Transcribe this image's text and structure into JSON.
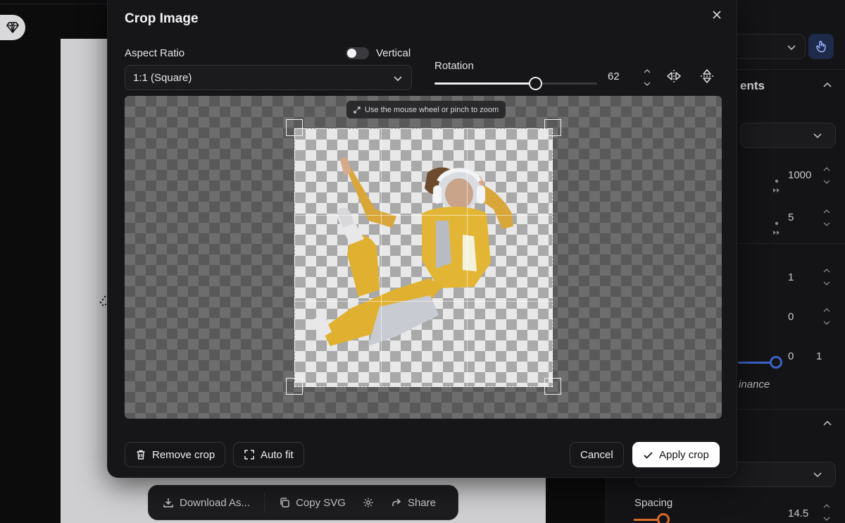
{
  "modal": {
    "title": "Crop Image",
    "aspect_ratio": {
      "label": "Aspect Ratio",
      "selected": "1:1 (Square)",
      "vertical_label": "Vertical",
      "vertical_on": false
    },
    "rotation": {
      "label": "Rotation",
      "value": "62",
      "level": 0.62
    },
    "hint": "Use the mouse wheel or pinch to zoom",
    "footer": {
      "remove_crop": "Remove crop",
      "auto_fit": "Auto fit",
      "cancel": "Cancel",
      "apply_crop": "Apply crop"
    }
  },
  "toolbar": {
    "download": "Download As...",
    "copy_svg": "Copy SVG",
    "share": "Share"
  },
  "right_panel": {
    "section_partial": "ents",
    "value_1": "1000",
    "value_2": "5",
    "value_3": "1",
    "value_4": "0",
    "range_min": "0",
    "range_max": "1",
    "italic_partial": "inance",
    "spacing_label": "Spacing",
    "spacing_value": "14.5"
  },
  "colors": {
    "accent_blue": "#3d63c8",
    "accent_orange": "#d86a2b",
    "primary_button": "#ffffff"
  }
}
